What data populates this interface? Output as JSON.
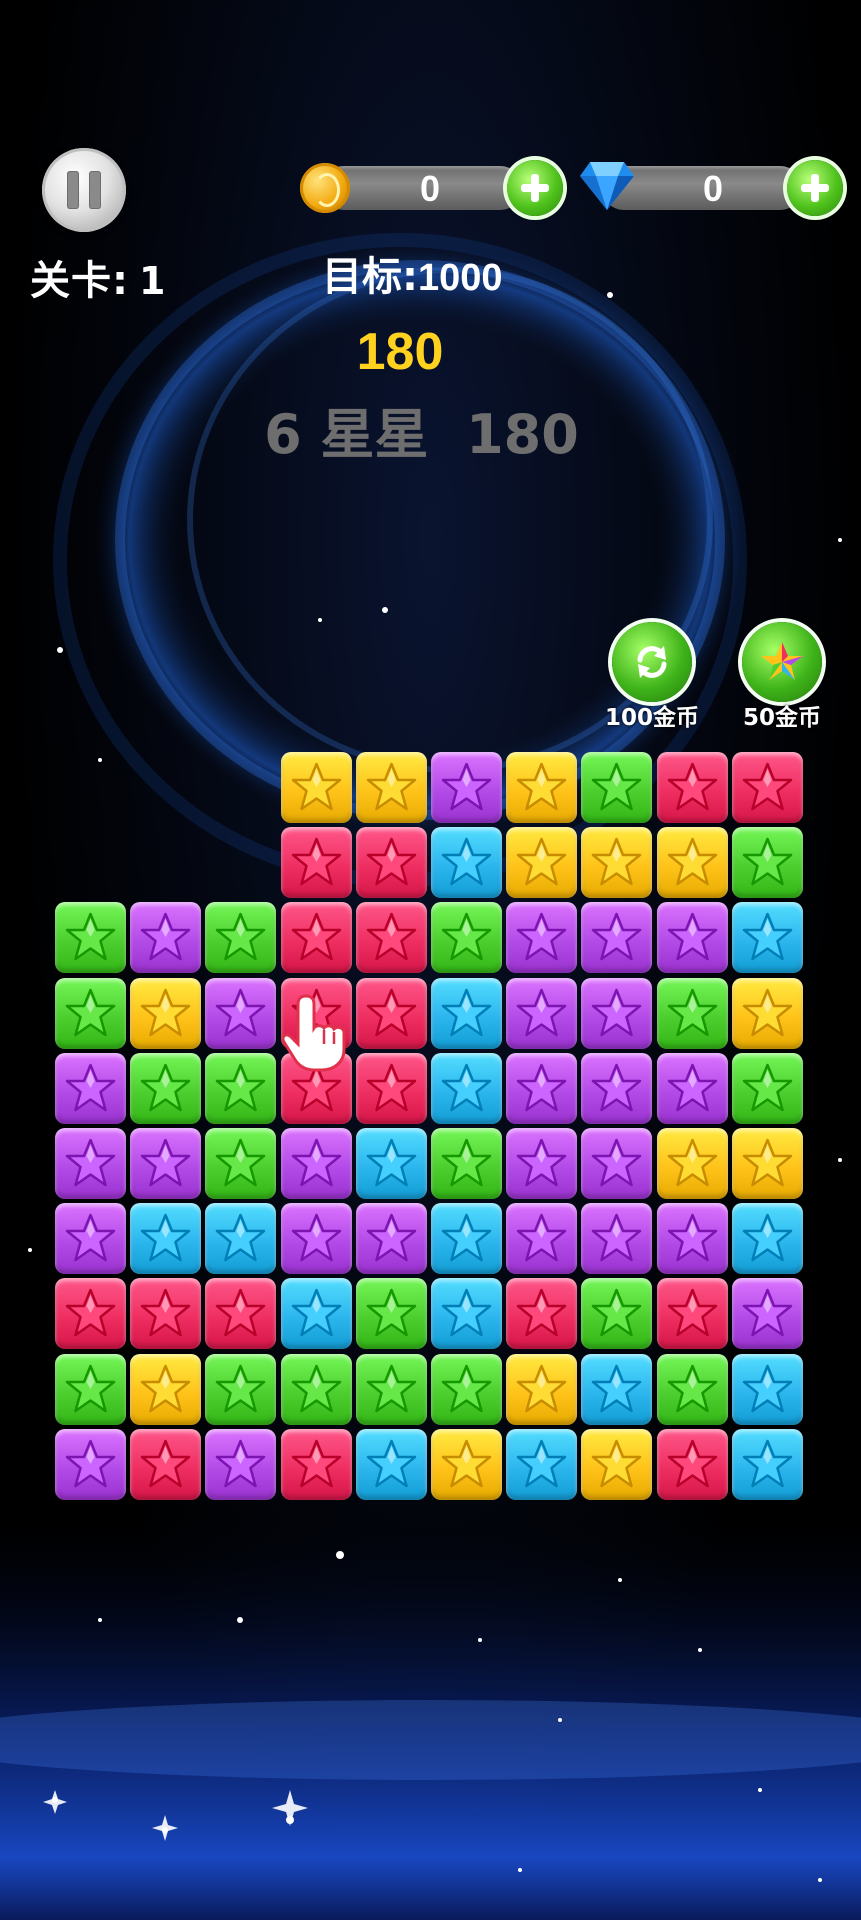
{
  "hud": {
    "level_label": "关卡:",
    "level_value": "1",
    "coins": "0",
    "gems": "0",
    "target_label": "目标:",
    "target_value": "1000",
    "score": "180",
    "combo_text": "6 星星  180"
  },
  "tools": [
    {
      "name": "refresh",
      "icon": "refresh-icon",
      "price": "100金币"
    },
    {
      "name": "color-change",
      "icon": "color-star-icon",
      "price": "50金币"
    }
  ],
  "colors": {
    "R": "#ef2f62",
    "Y": "#ffc31a",
    "P": "#b34be8",
    "G": "#4ccf2f",
    "B": "#2cb6ee"
  },
  "board": {
    "rows": 10,
    "cols": 10,
    "cells": [
      "...YYPYGRR",
      "...RRBYYYG",
      "GPGRRGPPPB",
      "GYPRRBPPGY",
      "PGGRRBPPPG",
      "PPGPBGPPYY",
      "PBBPPBPPPB",
      "RRRBGBRGRP",
      "GYGGGGYBGB",
      "PRPRBYBYRB"
    ]
  }
}
